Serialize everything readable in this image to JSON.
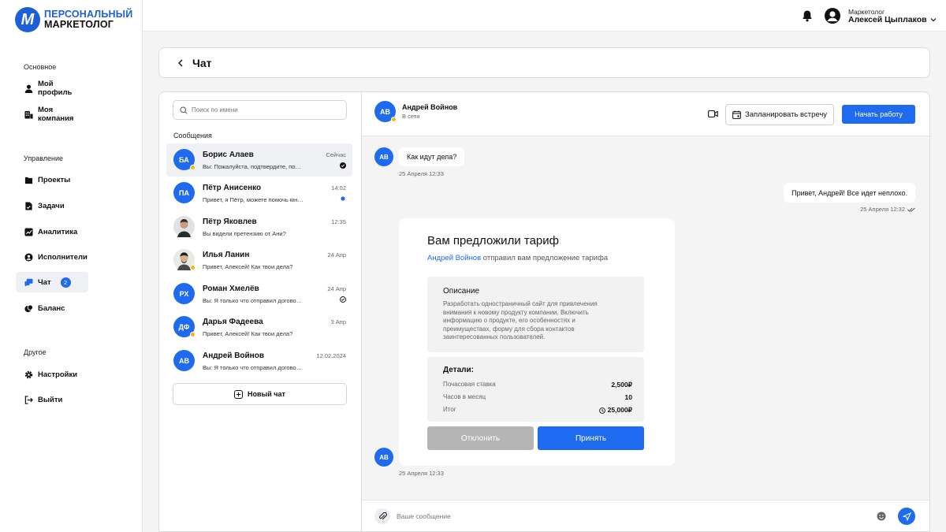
{
  "brand": {
    "line1": "ПЕРСОНАЛЬНЫЙ",
    "line2": "МАРКЕТОЛОГ",
    "mark": "M"
  },
  "colors": {
    "accent": "#1f6bf0",
    "online": "#f5b50a",
    "decline": "#b5b5b5"
  },
  "sidebar": {
    "sections": [
      {
        "title": "Основное",
        "items": [
          {
            "label": "Мой профиль",
            "icon": "user-icon"
          },
          {
            "label": "Моя компания",
            "icon": "company-icon"
          }
        ]
      },
      {
        "title": "Управление",
        "items": [
          {
            "label": "Проекты",
            "icon": "folder-icon"
          },
          {
            "label": "Задачи",
            "icon": "tasks-icon"
          },
          {
            "label": "Аналитика",
            "icon": "analytics-icon"
          },
          {
            "label": "Исполнители",
            "icon": "performers-icon"
          },
          {
            "label": "Чат",
            "icon": "chat-icon",
            "badge": "2",
            "active": true
          },
          {
            "label": "Баланс",
            "icon": "balance-icon"
          }
        ]
      },
      {
        "title": "Другое",
        "items": [
          {
            "label": "Настройки",
            "icon": "settings-icon"
          },
          {
            "label": "Выйти",
            "icon": "logout-icon"
          }
        ]
      }
    ]
  },
  "header": {
    "role": "Маркетолог",
    "name": "Алексей Цыплаков"
  },
  "page": {
    "title": "Чат"
  },
  "chat_list": {
    "search_placeholder": "Поиск по имени",
    "heading": "Сообщения",
    "new_chat": "Новый чат",
    "conversations": [
      {
        "initials": "БА",
        "name": "Борис Алаев",
        "preview": "Вы: Пожалуйста, подтвердите, получили ли вы мой файл",
        "time": "Сейчас",
        "status": "read",
        "online": true,
        "active": true
      },
      {
        "initials": "ПА",
        "name": "Пётр Анисенко",
        "preview": "Привет, я Пётр, можете помочь мне с проектом?",
        "time": "14:02",
        "status": "unread",
        "online": false
      },
      {
        "initials": "",
        "name": "Пётр Яковлев",
        "preview": "Вы видели претензию от Ани?",
        "time": "12:35",
        "status": "",
        "photo": true,
        "online": false
      },
      {
        "initials": "",
        "name": "Илья Ланин",
        "preview": "Привет, Алексей! Как твои дела?",
        "time": "24 Апр",
        "status": "",
        "photo": true,
        "online": true
      },
      {
        "initials": "РХ",
        "name": "Роман Хмелёв",
        "preview": "Вы: Я только что отправил договор на подпись",
        "time": "24 Апр",
        "status": "sent",
        "online": false
      },
      {
        "initials": "ДФ",
        "name": "Дарья Фадеева",
        "preview": "Привет, Алексей! Как твои дела?",
        "time": "3 Апр",
        "status": "",
        "online": true
      },
      {
        "initials": "АВ",
        "name": "Андрей Войнов",
        "preview": "Вы: Я только что отправил договор на подпись",
        "time": "12.02.2024",
        "status": "",
        "online": false
      }
    ]
  },
  "conversation": {
    "contact": {
      "initials": "АВ",
      "name": "Андрей Войнов",
      "status": "В сети"
    },
    "schedule_label": "Запланировать встречу",
    "start_label": "Начать работу",
    "messages": [
      {
        "from": "АВ",
        "text": "Как идут дела?",
        "time": "25 Апреля 12:33"
      },
      {
        "from": "me",
        "text": "Привет, Андрей! Все идет неплохо.",
        "time": "25 Апреля 12:32"
      }
    ],
    "offer": {
      "title": "Вам предложили тариф",
      "sender": "Андрей Войнов",
      "subtitle": "отправил вам предложение тарифа",
      "desc_title": "Описание",
      "desc_text": "Разработать одностраничный сайт для привлечения внимания к новому продукту компании. Включить информацию о продукте, его особенностях и преимуществах, форму для сбора контактов заинтересованных пользователей.",
      "details_title": "Детали:",
      "rows": [
        {
          "label": "Почасовая ставка",
          "value": "2,500₽"
        },
        {
          "label": "Часов в месяц",
          "value": "10"
        },
        {
          "label": "Итог",
          "value": "25,000₽"
        }
      ],
      "decline": "Отклонить",
      "accept": "Принять",
      "time": "25 Апреля 12:33",
      "from": "АВ"
    },
    "composer_placeholder": "Ваше сообщение"
  }
}
